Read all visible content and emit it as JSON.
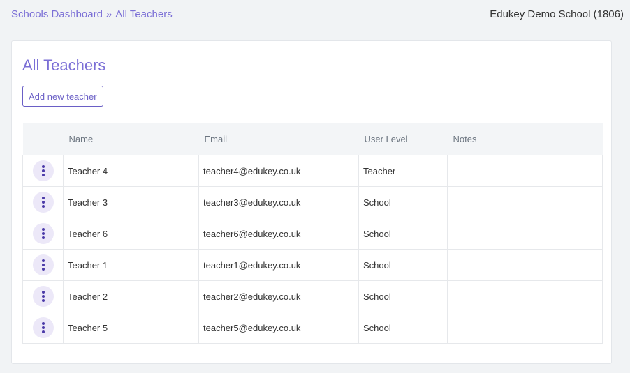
{
  "header": {
    "breadcrumb": [
      {
        "label": "Schools Dashboard"
      },
      {
        "label": "All Teachers"
      }
    ],
    "separator": "»",
    "school_name": "Edukey Demo School (1806)"
  },
  "main": {
    "title": "All Teachers",
    "add_button_label": "Add new teacher",
    "table": {
      "columns": [
        "",
        "Name",
        "Email",
        "User Level",
        "Notes"
      ],
      "rows": [
        {
          "name": "Teacher 4",
          "email": "teacher4@edukey.co.uk",
          "level": "Teacher",
          "notes": ""
        },
        {
          "name": "Teacher 3",
          "email": "teacher3@edukey.co.uk",
          "level": "School",
          "notes": ""
        },
        {
          "name": "Teacher 6",
          "email": "teacher6@edukey.co.uk",
          "level": "School",
          "notes": ""
        },
        {
          "name": "Teacher 1",
          "email": "teacher1@edukey.co.uk",
          "level": "School",
          "notes": ""
        },
        {
          "name": "Teacher 2",
          "email": "teacher2@edukey.co.uk",
          "level": "School",
          "notes": ""
        },
        {
          "name": "Teacher 5",
          "email": "teacher5@edukey.co.uk",
          "level": "School",
          "notes": ""
        }
      ],
      "row_action_icon": "kebab-menu-icon"
    }
  },
  "colors": {
    "accent": "#7b6fd6",
    "button_border": "#6a5fc6",
    "menu_bg": "#ece8f8",
    "menu_dots": "#4b3aa8",
    "page_bg": "#f1f3f5"
  }
}
